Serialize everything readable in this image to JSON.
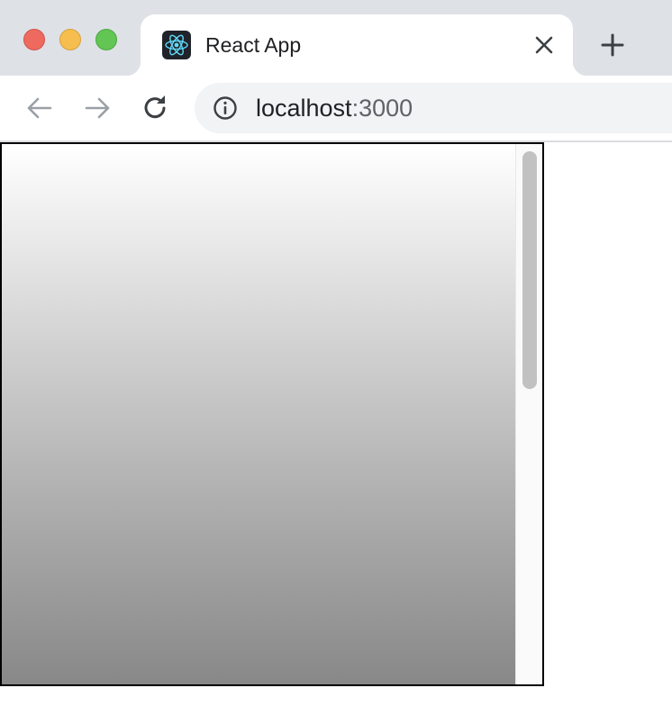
{
  "window": {
    "controls": {
      "close_color": "#ee6a5f",
      "minimize_color": "#f5be4f",
      "maximize_color": "#62c554"
    }
  },
  "tab": {
    "title": "React App",
    "favicon": "react-logo-icon",
    "close_icon": "close-icon"
  },
  "new_tab_icon": "plus-icon",
  "toolbar": {
    "back_icon": "arrow-left-icon",
    "forward_icon": "arrow-right-icon",
    "reload_icon": "reload-icon",
    "info_icon": "info-icon"
  },
  "address_bar": {
    "host": "localhost",
    "port": ":3000"
  },
  "page": {
    "content": "gradient-box",
    "gradient_top_color": "#ffffff",
    "gradient_bottom_color": "#888888",
    "scrollbar": "vertical-scrollbar"
  }
}
